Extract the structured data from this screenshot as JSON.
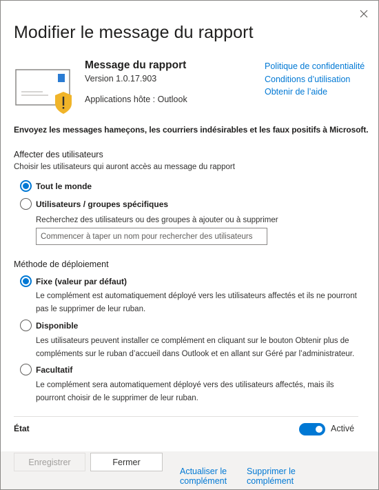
{
  "dialog": {
    "title": "Modifier le message du rapport",
    "close_icon": "close-icon"
  },
  "addin": {
    "name": "Message du rapport",
    "version": "Version 1.0.17.903",
    "hosts": "Applications hôte : Outlook",
    "icon": "report-message-icon",
    "links": {
      "privacy": "Politique de confidentialité",
      "terms": "Conditions d’utilisation",
      "help": "Obtenir de l’aide"
    }
  },
  "description": "Envoyez les messages hameçons, les courriers indésirables et les faux positifs à Microsoft.",
  "assign": {
    "title": "Affecter des utilisateurs",
    "subtitle": "Choisir les utilisateurs qui auront accès au message du rapport",
    "options": {
      "everyone": {
        "label": "Tout le monde",
        "checked": true
      },
      "specific": {
        "label": "Utilisateurs / groupes spécifiques",
        "checked": false
      }
    },
    "search_label": "Recherchez des utilisateurs ou des groupes à ajouter ou à supprimer",
    "search_placeholder": "Commencer à taper un nom pour rechercher des utilisateurs"
  },
  "deployment": {
    "title": "Méthode de déploiement",
    "options": {
      "fixed": {
        "label": "Fixe (valeur par défaut)",
        "checked": true,
        "help_line1": "Le complément est automatiquement déployé vers les utilisateurs affectés et ils ne pourront",
        "help_line2": "pas le supprimer de leur ruban."
      },
      "available": {
        "label": "Disponible",
        "checked": false,
        "help_line1": "Les utilisateurs peuvent installer ce complément en cliquant sur le bouton Obtenir plus de",
        "help_line2": "compléments sur le ruban d’accueil dans Outlook et en allant sur Géré par l’administrateur."
      },
      "optional": {
        "label": "Facultatif",
        "checked": false,
        "help_line1": "Le complément sera automatiquement déployé vers des utilisateurs affectés, mais ils",
        "help_line2": "pourront choisir de le supprimer de leur ruban."
      }
    }
  },
  "state": {
    "label": "État",
    "toggle_label": "Activé",
    "on": true
  },
  "footer": {
    "save_label": "Enregistrer",
    "close_label": "Fermer",
    "update_line1": "Actualiser le",
    "update_line2": "complément",
    "delete_line1": "Supprimer le",
    "delete_line2": "complément"
  },
  "colors": {
    "accent": "#0078d4",
    "warning": "#f0b429",
    "text": "#323130"
  }
}
